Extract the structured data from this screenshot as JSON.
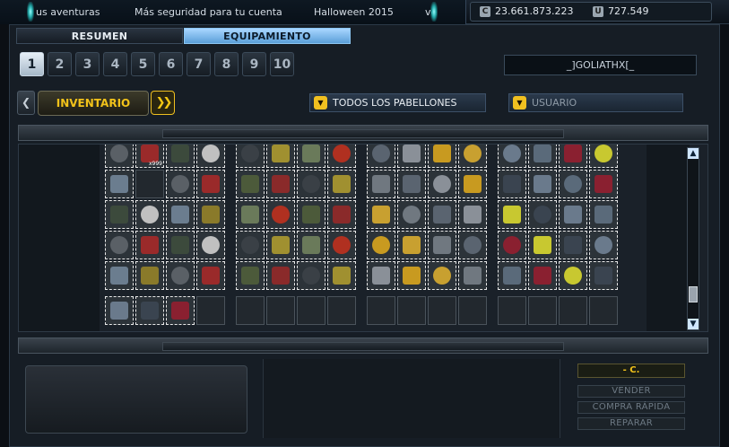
{
  "news": {
    "items": [
      "us aventuras",
      "Más seguridad para tu cuenta",
      "Halloween 2015",
      "ve"
    ]
  },
  "currency": {
    "credits": "23.661.873.223",
    "uridium": "727.549",
    "credits_icon": "credits-icon",
    "uridium_icon": "uridium-icon"
  },
  "tabs": {
    "resumen": "RESUMEN",
    "equipamiento": "EQUIPAMIENTO"
  },
  "pages": [
    "1",
    "2",
    "3",
    "4",
    "5",
    "6",
    "7",
    "8",
    "9",
    "10"
  ],
  "active_page": "1",
  "user": {
    "name": "_]GOLIATHX[_"
  },
  "filters": {
    "inventario": "INVENTARIO",
    "next_symbol": "❯❯",
    "prev_symbol": "❮",
    "pabellones": "TODOS LOS PABELLONES",
    "usuario": "USUARIO",
    "dropdown_icon": "▼"
  },
  "inventory": {
    "quantity_label": "x999"
  },
  "actions": {
    "price": "- C.",
    "vender": "VENDER",
    "compra_rapida": "COMPRA RÁPIDA",
    "reparar": "REPARAR"
  },
  "scroll": {
    "up": "▲",
    "down": "▼"
  }
}
